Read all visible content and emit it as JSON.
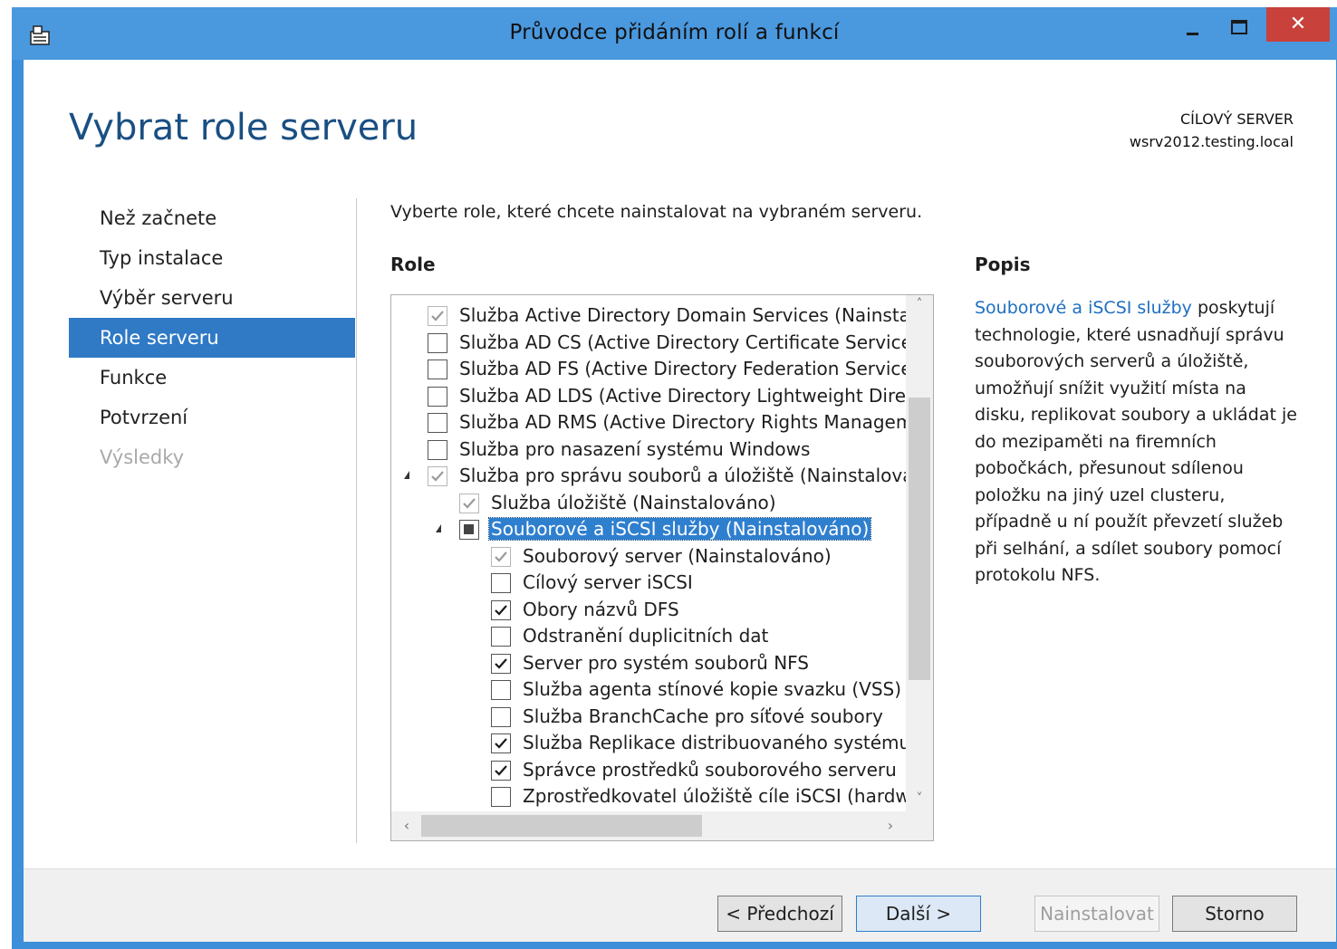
{
  "window": {
    "title": "Průvodce přidáním rolí a funkcí",
    "close_glyph": "✕"
  },
  "header": {
    "page_title": "Vybrat role serveru",
    "target_label": "CÍLOVÝ SERVER",
    "target_server": "wsrv2012.testing.local"
  },
  "nav": {
    "items": [
      {
        "label": "Než začnete",
        "state": "normal"
      },
      {
        "label": "Typ instalace",
        "state": "normal"
      },
      {
        "label": "Výběr serveru",
        "state": "normal"
      },
      {
        "label": "Role serveru",
        "state": "active"
      },
      {
        "label": "Funkce",
        "state": "normal"
      },
      {
        "label": "Potvrzení",
        "state": "normal"
      },
      {
        "label": "Výsledky",
        "state": "disabled"
      }
    ]
  },
  "main": {
    "instruction": "Vyberte role, které chcete nainstalovat na vybraném serveru.",
    "roles_heading": "Role",
    "roles": [
      {
        "label": "Služba Active Directory Domain Services (Nainstalováno)",
        "level": 0,
        "state": "checked-gray",
        "expander": false
      },
      {
        "label": "Služba AD CS (Active Directory Certificate Services)",
        "level": 0,
        "state": "unchecked",
        "expander": false
      },
      {
        "label": "Služba AD FS (Active Directory Federation Services)",
        "level": 0,
        "state": "unchecked",
        "expander": false
      },
      {
        "label": "Služba AD LDS (Active Directory Lightweight Directory Services)",
        "level": 0,
        "state": "unchecked",
        "expander": false
      },
      {
        "label": "Služba AD RMS (Active Directory Rights Management Services)",
        "level": 0,
        "state": "unchecked",
        "expander": false
      },
      {
        "label": "Služba pro nasazení systému Windows",
        "level": 0,
        "state": "unchecked",
        "expander": false
      },
      {
        "label": "Služba pro správu souborů a úložiště (Nainstalováno)",
        "level": 0,
        "state": "checked-gray",
        "expander": true
      },
      {
        "label": "Služba úložiště (Nainstalováno)",
        "level": 1,
        "state": "checked-gray",
        "expander": false
      },
      {
        "label": "Souborové a iSCSI služby (Nainstalováno)",
        "level": 1,
        "state": "partial",
        "expander": true,
        "selected": true
      },
      {
        "label": "Souborový server (Nainstalováno)",
        "level": 2,
        "state": "checked-gray",
        "expander": false
      },
      {
        "label": "Cílový server iSCSI",
        "level": 2,
        "state": "unchecked",
        "expander": false
      },
      {
        "label": "Obory názvů DFS",
        "level": 2,
        "state": "checked",
        "expander": false
      },
      {
        "label": "Odstranění duplicitních dat",
        "level": 2,
        "state": "unchecked",
        "expander": false
      },
      {
        "label": "Server pro systém souborů NFS",
        "level": 2,
        "state": "checked",
        "expander": false
      },
      {
        "label": "Služba agenta stínové kopie svazku (VSS) s",
        "level": 2,
        "state": "unchecked",
        "expander": false
      },
      {
        "label": "Služba BranchCache pro síťové soubory",
        "level": 2,
        "state": "unchecked",
        "expander": false
      },
      {
        "label": "Služba Replikace distribuovaného systému",
        "level": 2,
        "state": "checked",
        "expander": false
      },
      {
        "label": "Správce prostředků souborového serveru",
        "level": 2,
        "state": "checked",
        "expander": false
      },
      {
        "label": "Zprostředkovatel úložiště cíle iSCSI (hardwa",
        "level": 2,
        "state": "unchecked",
        "expander": false
      }
    ],
    "scroll": {
      "up": "˄",
      "down": "˅",
      "left": "‹",
      "right": "›"
    }
  },
  "description": {
    "heading": "Popis",
    "link_text": "Souborové a iSCSI služby",
    "body": " poskytují technologie, které usnadňují správu souborových serverů a úložiště, umožňují snížit využití místa na disku, replikovat soubory a ukládat je do mezipaměti na firemních pobočkách, přesunout sdílenou položku na jiný uzel clusteru, případně u ní použít převzetí služeb při selhání, a sdílet soubory pomocí protokolu NFS."
  },
  "footer": {
    "prev_label": "< Předchozí",
    "next_label": "Další >",
    "install_label": "Nainstalovat",
    "cancel_label": "Storno"
  },
  "colors": {
    "title_bar": "#4a98de",
    "accent": "#2f79c5",
    "close_button": "#c8413a",
    "link": "#1e6fc0"
  }
}
